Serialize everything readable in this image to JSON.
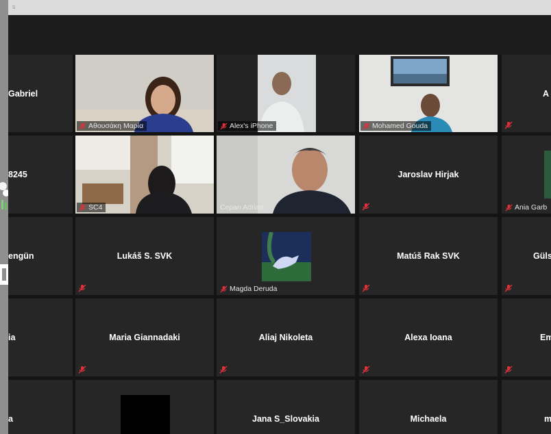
{
  "window": {
    "title": "s"
  },
  "participants": {
    "r0c0": "Gabriel",
    "r0c1": "Αθουσάκη Μαρία",
    "r0c2": "Alex's iPhone",
    "r0c3": "Mohamed Gouda",
    "r0c4": "A",
    "r1c0": "8245",
    "r1c1": "SC4",
    "r1c2": "Cepan Adrian",
    "r1c3": "Jaroslav Hirjak",
    "r1c4": "Ania Garb",
    "r2c0": "engün",
    "r2c1": "Lukáš S. SVK",
    "r2c2": "Magda Deruda",
    "r2c3": "Matúš Rak SVK",
    "r2c4": "Güls",
    "r3c0": "ia",
    "r3c1": "Maria Giannadaki",
    "r3c2": "Aliaj Nikoleta",
    "r3c3": "Alexa Ioana",
    "r3c4": "Em",
    "r4c0": "a",
    "r4c2": "Jana S_Slovakia",
    "r4c3": "Michaela",
    "r4c4": "m"
  },
  "icons": {
    "muted": "mic-muted-icon"
  },
  "colors": {
    "tile": "#262626",
    "background": "#141414",
    "muted_icon": "#e0303a"
  }
}
